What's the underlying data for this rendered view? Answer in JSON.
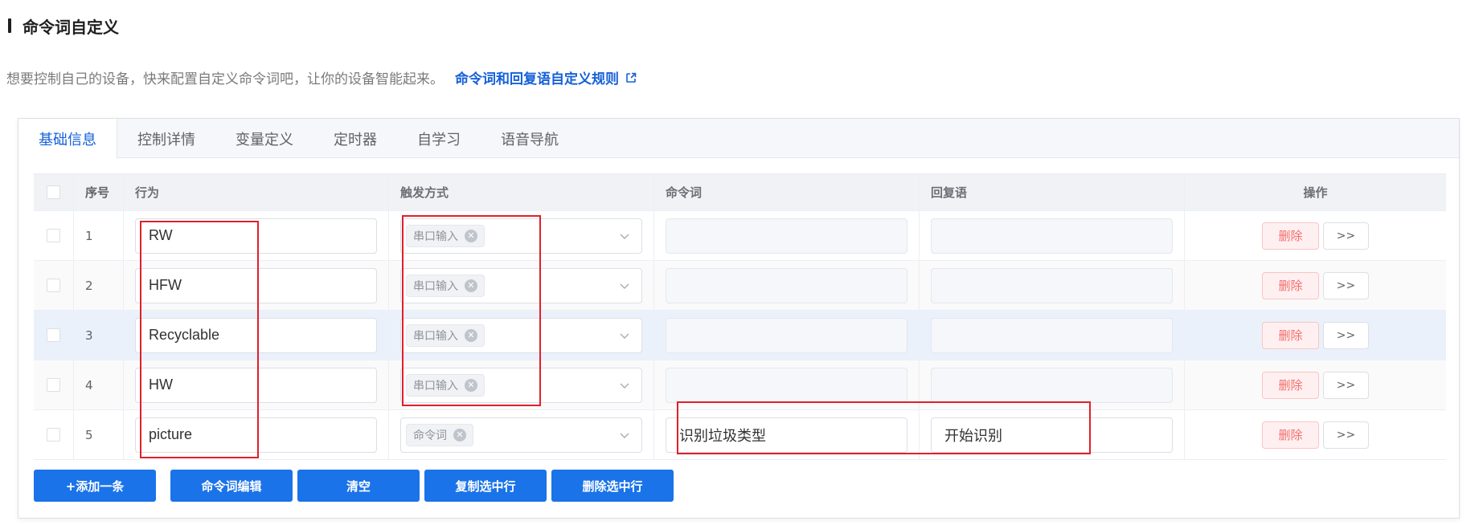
{
  "header": {
    "title": "命令词自定义"
  },
  "description": {
    "text": "想要控制自己的设备，快来配置自定义命令词吧，让你的设备智能起来。",
    "link_label": "命令词和回复语自定义规则",
    "link_icon": "external-link-icon"
  },
  "tabs": [
    {
      "label": "基础信息",
      "active": true
    },
    {
      "label": "控制详情",
      "active": false
    },
    {
      "label": "变量定义",
      "active": false
    },
    {
      "label": "定时器",
      "active": false
    },
    {
      "label": "自学习",
      "active": false
    },
    {
      "label": "语音导航",
      "active": false
    }
  ],
  "table": {
    "columns": {
      "index": "序号",
      "action": "行为",
      "trigger": "触发方式",
      "command": "命令词",
      "reply": "回复语",
      "ops": "操作"
    },
    "rows": [
      {
        "index": "1",
        "action": "RW",
        "trigger": "串口输入",
        "command": "",
        "reply": ""
      },
      {
        "index": "2",
        "action": "HFW",
        "trigger": "串口输入",
        "command": "",
        "reply": ""
      },
      {
        "index": "3",
        "action": "Recyclable",
        "trigger": "串口输入",
        "command": "",
        "reply": ""
      },
      {
        "index": "4",
        "action": "HW",
        "trigger": "串口输入",
        "command": "",
        "reply": ""
      },
      {
        "index": "5",
        "action": "picture",
        "trigger": "命令词",
        "command": "识别垃圾类型",
        "reply": "开始识别"
      }
    ],
    "row_delete_label": "删除",
    "row_more_label": ">>"
  },
  "actions": {
    "add": "+添加一条",
    "edit": "命令词编辑",
    "clear": "清空",
    "copy": "复制选中行",
    "delete": "删除选中行"
  },
  "colors": {
    "primary": "#1a73e8",
    "link": "#1660d9",
    "danger": "#f56c6c",
    "annotation": "#e0202a"
  }
}
